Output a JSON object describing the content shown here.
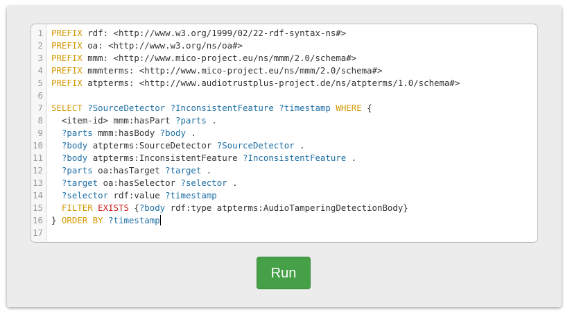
{
  "editor": {
    "lines": [
      [
        {
          "t": "PREFIX",
          "c": "kw"
        },
        {
          "t": " rdf: <http://www.w3.org/1999/02/22-rdf-syntax-ns#>",
          "c": "plain"
        }
      ],
      [
        {
          "t": "PREFIX",
          "c": "kw"
        },
        {
          "t": " oa: <http://www.w3.org/ns/oa#>",
          "c": "plain"
        }
      ],
      [
        {
          "t": "PREFIX",
          "c": "kw"
        },
        {
          "t": " mmm: <http://www.mico-project.eu/ns/mmm/2.0/schema#>",
          "c": "plain"
        }
      ],
      [
        {
          "t": "PREFIX",
          "c": "kw"
        },
        {
          "t": " mmmterms: <http://www.mico-project.eu/ns/mmm/2.0/schema#>",
          "c": "plain"
        }
      ],
      [
        {
          "t": "PREFIX",
          "c": "kw"
        },
        {
          "t": " atpterms: <http://www.audiotrustplus-project.de/ns/atpterms/1.0/schema#>",
          "c": "plain"
        }
      ],
      [],
      [
        {
          "t": "SELECT",
          "c": "kw"
        },
        {
          "t": " ",
          "c": "plain"
        },
        {
          "t": "?SourceDetector",
          "c": "var"
        },
        {
          "t": " ",
          "c": "plain"
        },
        {
          "t": "?InconsistentFeature",
          "c": "var"
        },
        {
          "t": " ",
          "c": "plain"
        },
        {
          "t": "?timestamp",
          "c": "var"
        },
        {
          "t": " ",
          "c": "plain"
        },
        {
          "t": "WHERE",
          "c": "kw"
        },
        {
          "t": " {",
          "c": "plain"
        }
      ],
      [
        {
          "t": "  <item-id> mmm:hasPart ",
          "c": "plain"
        },
        {
          "t": "?parts",
          "c": "var"
        },
        {
          "t": " .",
          "c": "plain"
        }
      ],
      [
        {
          "t": "  ",
          "c": "plain"
        },
        {
          "t": "?parts",
          "c": "var"
        },
        {
          "t": " mmm:hasBody ",
          "c": "plain"
        },
        {
          "t": "?body",
          "c": "var"
        },
        {
          "t": " .",
          "c": "plain"
        }
      ],
      [
        {
          "t": "  ",
          "c": "plain"
        },
        {
          "t": "?body",
          "c": "var"
        },
        {
          "t": " atpterms:SourceDetector ",
          "c": "plain"
        },
        {
          "t": "?SourceDetector",
          "c": "var"
        },
        {
          "t": " .",
          "c": "plain"
        }
      ],
      [
        {
          "t": "  ",
          "c": "plain"
        },
        {
          "t": "?body",
          "c": "var"
        },
        {
          "t": " atpterms:InconsistentFeature ",
          "c": "plain"
        },
        {
          "t": "?InconsistentFeature",
          "c": "var"
        },
        {
          "t": " .",
          "c": "plain"
        }
      ],
      [
        {
          "t": "  ",
          "c": "plain"
        },
        {
          "t": "?parts",
          "c": "var"
        },
        {
          "t": " oa:hasTarget ",
          "c": "plain"
        },
        {
          "t": "?target",
          "c": "var"
        },
        {
          "t": " .",
          "c": "plain"
        }
      ],
      [
        {
          "t": "  ",
          "c": "plain"
        },
        {
          "t": "?target",
          "c": "var"
        },
        {
          "t": " oa:hasSelector ",
          "c": "plain"
        },
        {
          "t": "?selector",
          "c": "var"
        },
        {
          "t": " .",
          "c": "plain"
        }
      ],
      [
        {
          "t": "  ",
          "c": "plain"
        },
        {
          "t": "?selector",
          "c": "var"
        },
        {
          "t": " rdf:value ",
          "c": "plain"
        },
        {
          "t": "?timestamp",
          "c": "var"
        }
      ],
      [
        {
          "t": "  ",
          "c": "plain"
        },
        {
          "t": "FILTER",
          "c": "kw"
        },
        {
          "t": " ",
          "c": "plain"
        },
        {
          "t": "EXISTS",
          "c": "builtin"
        },
        {
          "t": " {",
          "c": "plain"
        },
        {
          "t": "?body",
          "c": "var"
        },
        {
          "t": " rdf:type atpterms:AudioTamperingDetectionBody}",
          "c": "plain"
        }
      ],
      [
        {
          "t": "} ",
          "c": "plain"
        },
        {
          "t": "ORDER BY",
          "c": "kw"
        },
        {
          "t": " ",
          "c": "plain"
        },
        {
          "t": "?timestamp",
          "c": "var"
        }
      ],
      []
    ],
    "cursor_line": 16,
    "colors": {
      "keyword": "#d39800",
      "variable": "#1d6fa5",
      "builtin": "#cf1b1b",
      "plain": "#333333",
      "line_number": "#999999"
    }
  },
  "run_button": {
    "label": "Run",
    "color": "#45a047"
  }
}
